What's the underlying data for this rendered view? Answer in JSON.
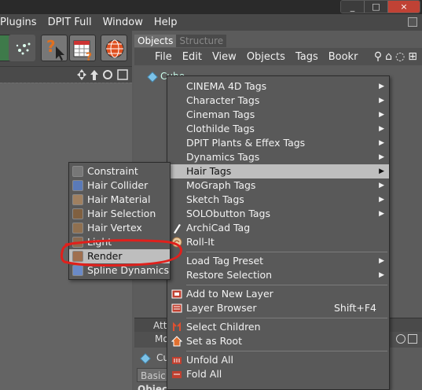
{
  "window": {
    "buttons": [
      "_",
      "□",
      "×"
    ]
  },
  "menubar": [
    "Plugins",
    "DPIT Full",
    "Window",
    "Help"
  ],
  "object_manager": {
    "tabs": [
      "Objects",
      "Structure"
    ],
    "menu": [
      "File",
      "Edit",
      "View",
      "Objects",
      "Tags",
      "Bookr"
    ],
    "object_name": "Cube"
  },
  "attributes": {
    "header": "Attr",
    "mode": "Mo",
    "object_short": "Cu",
    "tab": "Basic",
    "footer": "Object"
  },
  "context_menu": {
    "items": [
      {
        "label": "CINEMA 4D Tags",
        "sub": true
      },
      {
        "label": "Character Tags",
        "sub": true
      },
      {
        "label": "Cineman Tags",
        "sub": true
      },
      {
        "label": "Clothilde Tags",
        "sub": true
      },
      {
        "label": "DPIT Plants & Effex Tags",
        "sub": true
      },
      {
        "label": "Dynamics Tags",
        "sub": true
      },
      {
        "label": "Hair Tags",
        "sub": true,
        "highlighted": true
      },
      {
        "label": "MoGraph Tags",
        "sub": true
      },
      {
        "label": "Sketch Tags",
        "sub": true
      },
      {
        "label": "SOLObutton Tags",
        "sub": true
      },
      {
        "label": "ArchiCad Tag",
        "sub": false
      },
      {
        "label": "Roll-It",
        "sub": false
      },
      {
        "label": "Load Tag Preset",
        "sub": true
      },
      {
        "label": "Restore Selection",
        "sub": true
      },
      {
        "label": "Add to New Layer",
        "sub": false
      },
      {
        "label": "Layer Browser",
        "sub": false,
        "shortcut": "Shift+F4"
      },
      {
        "label": "Select Children",
        "sub": false
      },
      {
        "label": "Set as Root",
        "sub": false
      },
      {
        "label": "Unfold All",
        "sub": false
      },
      {
        "label": "Fold All",
        "sub": false
      }
    ]
  },
  "hair_submenu": {
    "items": [
      {
        "label": "Constraint"
      },
      {
        "label": "Hair Collider"
      },
      {
        "label": "Hair Material"
      },
      {
        "label": "Hair Selection"
      },
      {
        "label": "Hair Vertex"
      },
      {
        "label": "Light"
      },
      {
        "label": "Render",
        "highlighted": true
      },
      {
        "label": "Spline Dynamics"
      }
    ]
  },
  "colors": {
    "menu_bg": "#595959",
    "highlight": "#bebebe",
    "annotation": "#e0201c"
  }
}
